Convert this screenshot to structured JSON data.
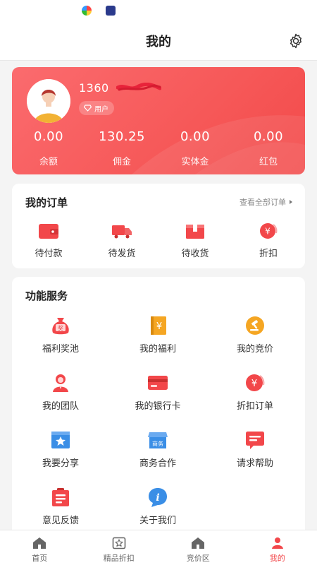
{
  "header": {
    "title": "我的"
  },
  "profile": {
    "phone": "1360",
    "badge": "用户",
    "stats": [
      {
        "value": "0.00",
        "label": "余额"
      },
      {
        "value": "130.25",
        "label": "佣金"
      },
      {
        "value": "0.00",
        "label": "实体金"
      },
      {
        "value": "0.00",
        "label": "红包"
      }
    ]
  },
  "orders": {
    "title": "我的订单",
    "view_all": "查看全部订单",
    "items": [
      {
        "label": "待付款",
        "icon": "wallet-icon"
      },
      {
        "label": "待发货",
        "icon": "truck-icon"
      },
      {
        "label": "待收货",
        "icon": "package-icon"
      },
      {
        "label": "折扣",
        "icon": "yen-coin-icon"
      }
    ]
  },
  "services": {
    "title": "功能服务",
    "items": [
      {
        "label": "福利奖池",
        "icon": "prize-bag-icon"
      },
      {
        "label": "我的福利",
        "icon": "welfare-book-icon"
      },
      {
        "label": "我的竞价",
        "icon": "auction-icon"
      },
      {
        "label": "我的团队",
        "icon": "team-icon"
      },
      {
        "label": "我的银行卡",
        "icon": "bank-card-icon"
      },
      {
        "label": "折扣订单",
        "icon": "discount-order-icon"
      },
      {
        "label": "我要分享",
        "icon": "share-icon"
      },
      {
        "label": "商务合作",
        "icon": "business-store-icon",
        "icon_text": "商务"
      },
      {
        "label": "请求帮助",
        "icon": "help-message-icon"
      },
      {
        "label": "意见反馈",
        "icon": "feedback-icon"
      },
      {
        "label": "关于我们",
        "icon": "info-icon",
        "icon_text": "i"
      }
    ]
  },
  "prize_icon_text": "奖",
  "yen_symbol": "¥",
  "tabbar": {
    "items": [
      {
        "label": "首页",
        "icon": "home-icon"
      },
      {
        "label": "精品折扣",
        "icon": "star-box-icon"
      },
      {
        "label": "竞价区",
        "icon": "home-icon"
      },
      {
        "label": "我的",
        "icon": "person-icon",
        "active": true
      }
    ]
  },
  "colors": {
    "accent": "#f2474a",
    "card_start": "#fb6b6e",
    "card_end": "#f24a4a",
    "blue": "#3a8ee6",
    "orange": "#f5a623"
  }
}
